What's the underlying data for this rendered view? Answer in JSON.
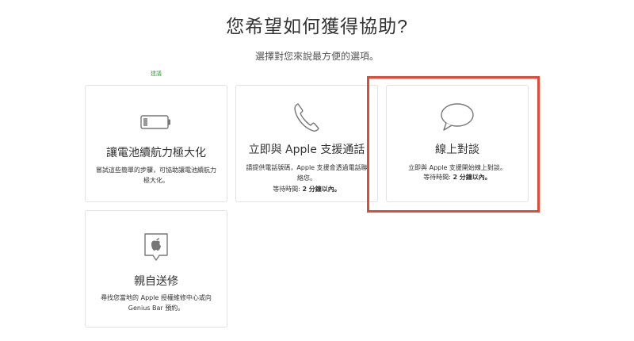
{
  "header": {
    "title": "您希望如何獲得協助?",
    "subtitle": "選擇對您來說最方便的選項。",
    "recommended_label": "建議"
  },
  "options": [
    {
      "title": "讓電池續航力極大化",
      "description": "嘗試這些簡單的步驟，可協助讓電池續航力極大化。",
      "icon": "battery-icon"
    },
    {
      "title": "立即與 Apple 支援通話",
      "description": "請提供電話號碼，Apple 支援會透過電話聯絡您。",
      "wait_label": "等待時間:",
      "wait_value": "2 分鐘以內。",
      "icon": "phone-icon"
    },
    {
      "title": "線上對談",
      "description": "立即與 Apple 支援開始線上對談。",
      "wait_label": "等待時間:",
      "wait_value": "2 分鐘以內。",
      "icon": "chat-bubble-icon"
    },
    {
      "title": "親自送修",
      "description": "尋找您當地的 Apple 授權維修中心或向 Genius Bar 預約。",
      "icon": "apple-store-icon"
    }
  ],
  "colors": {
    "highlight": "#e34a35",
    "recommended": "#3a9a3a"
  }
}
